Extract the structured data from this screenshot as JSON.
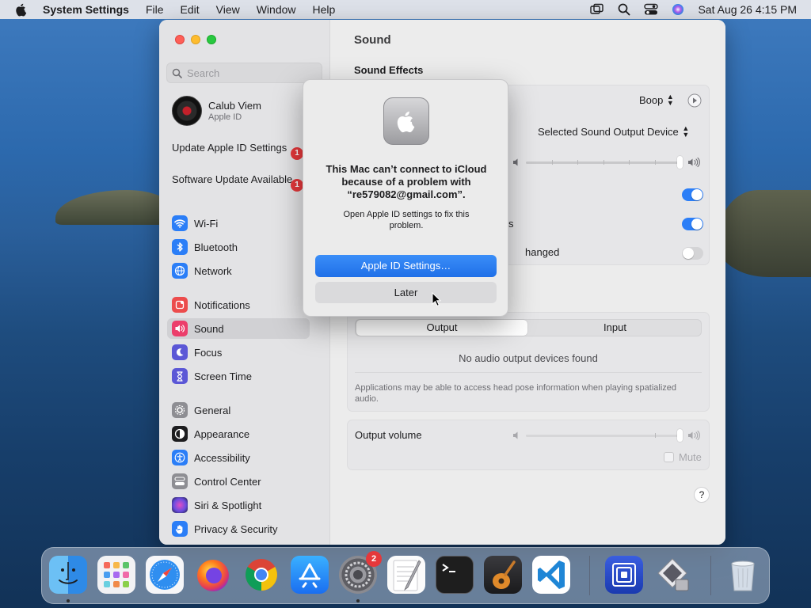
{
  "menubar": {
    "app": "System Settings",
    "items": [
      "File",
      "Edit",
      "View",
      "Window",
      "Help"
    ],
    "clock": "Sat Aug 26  4:15 PM"
  },
  "sidebar": {
    "search_placeholder": "Search",
    "account": {
      "name": "Calub Viem",
      "subtitle": "Apple ID"
    },
    "notices": [
      {
        "label": "Update Apple ID Settings",
        "badge": "1"
      },
      {
        "label": "Software Update Available",
        "badge": "1"
      }
    ],
    "items": [
      {
        "label": "Wi-Fi",
        "icon": "wifi-icon"
      },
      {
        "label": "Bluetooth",
        "icon": "bluetooth-icon"
      },
      {
        "label": "Network",
        "icon": "globe-icon"
      },
      {
        "label": "Notifications",
        "icon": "bell-icon"
      },
      {
        "label": "Sound",
        "icon": "speaker-icon"
      },
      {
        "label": "Focus",
        "icon": "moon-icon"
      },
      {
        "label": "Screen Time",
        "icon": "hourglass-icon"
      },
      {
        "label": "General",
        "icon": "gear-icon"
      },
      {
        "label": "Appearance",
        "icon": "appearance-icon"
      },
      {
        "label": "Accessibility",
        "icon": "accessibility-icon"
      },
      {
        "label": "Control Center",
        "icon": "control-center-icon"
      },
      {
        "label": "Siri & Spotlight",
        "icon": "siri-icon"
      },
      {
        "label": "Privacy & Security",
        "icon": "hand-icon"
      }
    ],
    "selected": "Sound"
  },
  "content": {
    "title": "Sound",
    "section_sound_effects": "Sound Effects",
    "alert_sound_value": "Boop",
    "play_through_value": "Selected Sound Output Device",
    "row_partial_text_1": "s",
    "row_partial_text_2": "hanged",
    "tabs": [
      "Output",
      "Input"
    ],
    "active_tab": "Output",
    "no_devices": "No audio output devices found",
    "head_pose_note": "Applications may be able to access head pose information when playing spatialized audio.",
    "output_volume_label": "Output volume",
    "mute_label": "Mute",
    "help": "?"
  },
  "dialog": {
    "title": "This Mac can’t connect to iCloud because of a problem with “re579082@gmail.com”.",
    "message": "Open Apple ID settings to fix this problem.",
    "primary_button": "Apple ID Settings…",
    "secondary_button": "Later"
  },
  "dock": {
    "apps": [
      "Finder",
      "Launchpad",
      "Safari",
      "Firefox",
      "Chrome",
      "App Store",
      "System Settings",
      "TextEdit",
      "Terminal",
      "GarageBand",
      "VS Code",
      "Screen Sharing",
      "Migration Assistant",
      "Trash"
    ],
    "settings_badge": "2"
  },
  "colors": {
    "accent": "#2b7ef7",
    "badge": "#e5383b",
    "selected_row": "#d1d1d4"
  }
}
